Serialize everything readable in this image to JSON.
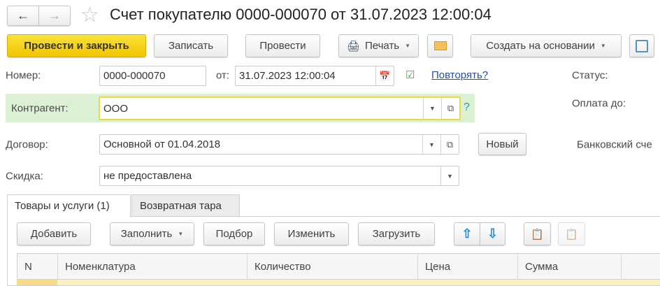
{
  "header": {
    "title": "Счет покупателю 0000-000070 от 31.07.2023 12:00:04"
  },
  "toolbar": {
    "post_close": "Провести и закрыть",
    "save": "Записать",
    "post": "Провести",
    "print": "Печать",
    "create_based": "Создать на основании"
  },
  "form": {
    "number_label": "Номер:",
    "number_value": "0000-000070",
    "date_label": "от:",
    "date_value": "31.07.2023 12:00:04",
    "repeat_link": "Повторять?",
    "status_label": "Статус:",
    "payment_label": "Оплата до:",
    "bank_label": "Банковский сче",
    "counterparty_label": "Контрагент:",
    "counterparty_value": "ООО",
    "help": "?",
    "contract_label": "Договор:",
    "contract_value": "Основной от 01.04.2018",
    "new_button": "Новый",
    "discount_label": "Скидка:",
    "discount_value": "не предоставлена"
  },
  "tabs": [
    {
      "label": "Товары и услуги (1)",
      "active": true
    },
    {
      "label": "Возвратная тара",
      "active": false
    }
  ],
  "table_toolbar": {
    "add": "Добавить",
    "fill": "Заполнить",
    "select": "Подбор",
    "edit": "Изменить",
    "load": "Загрузить"
  },
  "table": {
    "columns": [
      "N",
      "Номенклатура",
      "Количество",
      "Цена",
      "Сумма"
    ]
  }
}
